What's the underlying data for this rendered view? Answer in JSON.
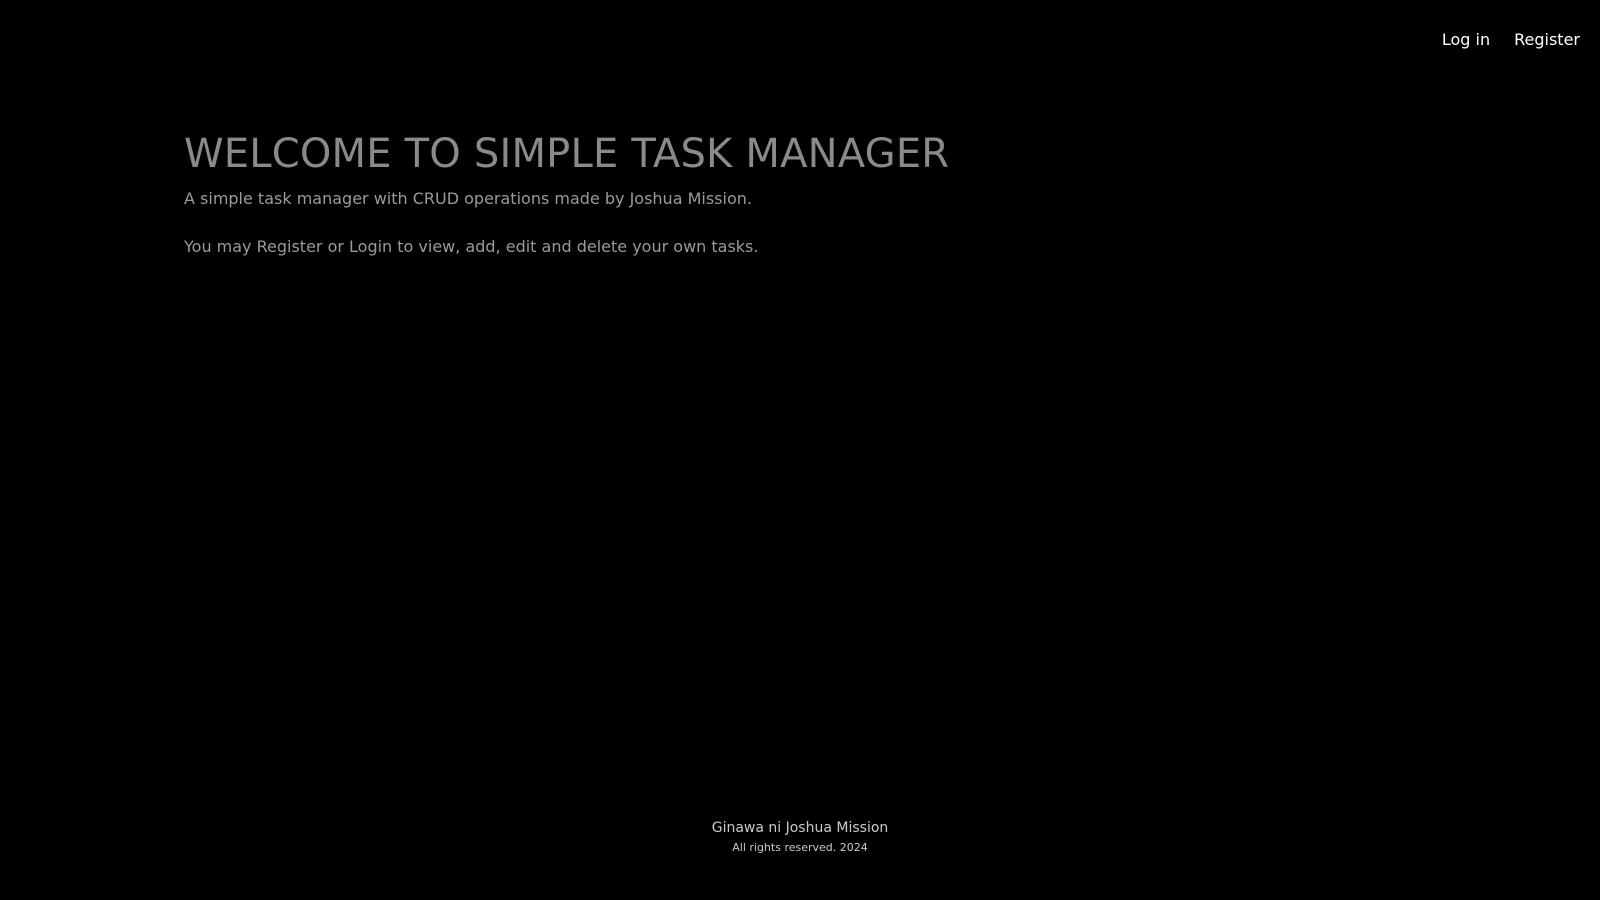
{
  "nav": {
    "login_label": "Log in",
    "register_label": "Register"
  },
  "hero": {
    "title": "WELCOME TO SIMPLE TASK MANAGER",
    "subtitle": "A simple task manager with CRUD operations made by Joshua Mission.",
    "note": "You may Register or Login to view, add, edit and delete your own tasks."
  },
  "footer": {
    "credit": "Ginawa ni Joshua Mission",
    "rights": "All rights reserved. 2024"
  },
  "colors": {
    "background": "#000000",
    "nav_text": "#ffffff",
    "title_text": "#8a8a8a",
    "body_text": "#9a9a9a",
    "footer_text": "#c9c9c9"
  }
}
